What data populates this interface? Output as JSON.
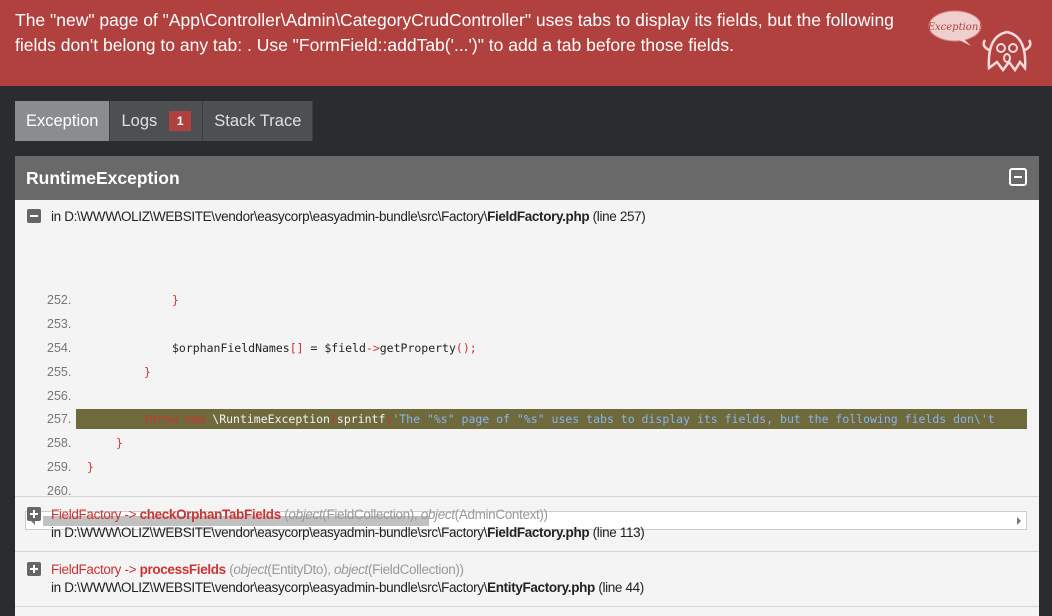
{
  "header": {
    "message": "The \"new\" page of \"App\\Controller\\Admin\\CategoryCrudController\" uses tabs to display its fields, but the following fields don't belong to any tab: . Use \"FormField::addTab('...')\" to add a tab before those fields.",
    "ghost_label": "Exception!"
  },
  "tabs": [
    {
      "label": "Exception"
    },
    {
      "label": "Logs",
      "badge": "1"
    },
    {
      "label": "Stack Trace"
    }
  ],
  "exception": {
    "title": "RuntimeException",
    "location_prefix": "in D:\\WWW\\OLIZ\\WEBSITE\\vendor\\easycorp\\easyadmin-bundle\\src\\Factory\\",
    "file": "FieldFactory.php",
    "line_text": "(line 257)"
  },
  "code_lines": [
    {
      "num": "252.",
      "html_key": "l252"
    },
    {
      "num": "253.",
      "html_key": "l253"
    },
    {
      "num": "254.",
      "html_key": "l254"
    },
    {
      "num": "255.",
      "html_key": "l255"
    },
    {
      "num": "256.",
      "html_key": "l256"
    },
    {
      "num": "257.",
      "html_key": "l257"
    },
    {
      "num": "258.",
      "html_key": "l258"
    },
    {
      "num": "259.",
      "html_key": "l259"
    },
    {
      "num": "260.",
      "html_key": "l260"
    }
  ],
  "code": {
    "l252": "}",
    "l254_var": "$orphanFieldNames",
    "l254_brackets": "[]",
    "l254_eq": " = ",
    "l254_field": "$field",
    "l254_arrow": "->",
    "l254_method": "getProperty",
    "l254_parens": "();",
    "l255": "}",
    "l257_throw": "throw",
    "l257_new": "new",
    "l257_class": " \\RuntimeException",
    "l257_paren": "(",
    "l257_fn": "sprintf",
    "l257_paren2": "(",
    "l257_str": "'The \"%s\" page of \"%s\" uses tabs to display its fields, but the following fields don\\'t",
    "l258": "}",
    "l259": "}"
  },
  "trace": [
    {
      "class": "FieldFactory",
      "arrow": " -> ",
      "method": "checkOrphanTabFields",
      "args_prefix": " (",
      "arg1_type": "object",
      "arg1_val": "(FieldCollection), ",
      "arg2_type": "object",
      "arg2_val": "(AdminContext))",
      "location_prefix": "in D:\\WWW\\OLIZ\\WEBSITE\\vendor\\easycorp\\easyadmin-bundle\\src\\Factory\\",
      "file": "FieldFactory.php",
      "line_text": "(line 113)"
    },
    {
      "class": "FieldFactory",
      "arrow": " -> ",
      "method": "processFields",
      "args_prefix": " (",
      "arg1_type": "object",
      "arg1_val": "(EntityDto), ",
      "arg2_type": "object",
      "arg2_val": "(FieldCollection))",
      "location_prefix": "in D:\\WWW\\OLIZ\\WEBSITE\\vendor\\easycorp\\easyadmin-bundle\\src\\Factory\\",
      "file": "EntityFactory.php",
      "line_text": "(line 44)"
    }
  ],
  "colors": {
    "header_bg": "#b0413e",
    "page_bg": "#2a2c30",
    "keyword": "#cc3333",
    "string": "#4a78c0",
    "highlight": "#6f6a3c"
  }
}
